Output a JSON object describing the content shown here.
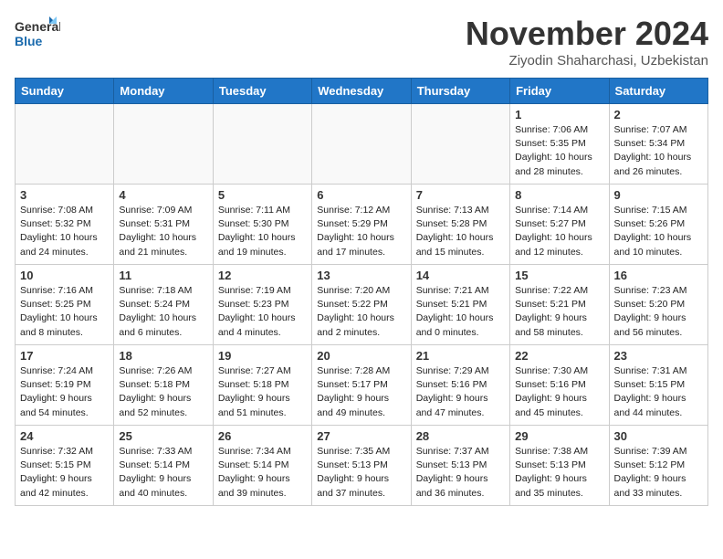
{
  "header": {
    "logo_line1": "General",
    "logo_line2": "Blue",
    "month_title": "November 2024",
    "location": "Ziyodin Shaharchasi, Uzbekistan"
  },
  "weekdays": [
    "Sunday",
    "Monday",
    "Tuesday",
    "Wednesday",
    "Thursday",
    "Friday",
    "Saturday"
  ],
  "weeks": [
    [
      {
        "day": "",
        "info": ""
      },
      {
        "day": "",
        "info": ""
      },
      {
        "day": "",
        "info": ""
      },
      {
        "day": "",
        "info": ""
      },
      {
        "day": "",
        "info": ""
      },
      {
        "day": "1",
        "info": "Sunrise: 7:06 AM\nSunset: 5:35 PM\nDaylight: 10 hours and 28 minutes."
      },
      {
        "day": "2",
        "info": "Sunrise: 7:07 AM\nSunset: 5:34 PM\nDaylight: 10 hours and 26 minutes."
      }
    ],
    [
      {
        "day": "3",
        "info": "Sunrise: 7:08 AM\nSunset: 5:32 PM\nDaylight: 10 hours and 24 minutes."
      },
      {
        "day": "4",
        "info": "Sunrise: 7:09 AM\nSunset: 5:31 PM\nDaylight: 10 hours and 21 minutes."
      },
      {
        "day": "5",
        "info": "Sunrise: 7:11 AM\nSunset: 5:30 PM\nDaylight: 10 hours and 19 minutes."
      },
      {
        "day": "6",
        "info": "Sunrise: 7:12 AM\nSunset: 5:29 PM\nDaylight: 10 hours and 17 minutes."
      },
      {
        "day": "7",
        "info": "Sunrise: 7:13 AM\nSunset: 5:28 PM\nDaylight: 10 hours and 15 minutes."
      },
      {
        "day": "8",
        "info": "Sunrise: 7:14 AM\nSunset: 5:27 PM\nDaylight: 10 hours and 12 minutes."
      },
      {
        "day": "9",
        "info": "Sunrise: 7:15 AM\nSunset: 5:26 PM\nDaylight: 10 hours and 10 minutes."
      }
    ],
    [
      {
        "day": "10",
        "info": "Sunrise: 7:16 AM\nSunset: 5:25 PM\nDaylight: 10 hours and 8 minutes."
      },
      {
        "day": "11",
        "info": "Sunrise: 7:18 AM\nSunset: 5:24 PM\nDaylight: 10 hours and 6 minutes."
      },
      {
        "day": "12",
        "info": "Sunrise: 7:19 AM\nSunset: 5:23 PM\nDaylight: 10 hours and 4 minutes."
      },
      {
        "day": "13",
        "info": "Sunrise: 7:20 AM\nSunset: 5:22 PM\nDaylight: 10 hours and 2 minutes."
      },
      {
        "day": "14",
        "info": "Sunrise: 7:21 AM\nSunset: 5:21 PM\nDaylight: 10 hours and 0 minutes."
      },
      {
        "day": "15",
        "info": "Sunrise: 7:22 AM\nSunset: 5:21 PM\nDaylight: 9 hours and 58 minutes."
      },
      {
        "day": "16",
        "info": "Sunrise: 7:23 AM\nSunset: 5:20 PM\nDaylight: 9 hours and 56 minutes."
      }
    ],
    [
      {
        "day": "17",
        "info": "Sunrise: 7:24 AM\nSunset: 5:19 PM\nDaylight: 9 hours and 54 minutes."
      },
      {
        "day": "18",
        "info": "Sunrise: 7:26 AM\nSunset: 5:18 PM\nDaylight: 9 hours and 52 minutes."
      },
      {
        "day": "19",
        "info": "Sunrise: 7:27 AM\nSunset: 5:18 PM\nDaylight: 9 hours and 51 minutes."
      },
      {
        "day": "20",
        "info": "Sunrise: 7:28 AM\nSunset: 5:17 PM\nDaylight: 9 hours and 49 minutes."
      },
      {
        "day": "21",
        "info": "Sunrise: 7:29 AM\nSunset: 5:16 PM\nDaylight: 9 hours and 47 minutes."
      },
      {
        "day": "22",
        "info": "Sunrise: 7:30 AM\nSunset: 5:16 PM\nDaylight: 9 hours and 45 minutes."
      },
      {
        "day": "23",
        "info": "Sunrise: 7:31 AM\nSunset: 5:15 PM\nDaylight: 9 hours and 44 minutes."
      }
    ],
    [
      {
        "day": "24",
        "info": "Sunrise: 7:32 AM\nSunset: 5:15 PM\nDaylight: 9 hours and 42 minutes."
      },
      {
        "day": "25",
        "info": "Sunrise: 7:33 AM\nSunset: 5:14 PM\nDaylight: 9 hours and 40 minutes."
      },
      {
        "day": "26",
        "info": "Sunrise: 7:34 AM\nSunset: 5:14 PM\nDaylight: 9 hours and 39 minutes."
      },
      {
        "day": "27",
        "info": "Sunrise: 7:35 AM\nSunset: 5:13 PM\nDaylight: 9 hours and 37 minutes."
      },
      {
        "day": "28",
        "info": "Sunrise: 7:37 AM\nSunset: 5:13 PM\nDaylight: 9 hours and 36 minutes."
      },
      {
        "day": "29",
        "info": "Sunrise: 7:38 AM\nSunset: 5:13 PM\nDaylight: 9 hours and 35 minutes."
      },
      {
        "day": "30",
        "info": "Sunrise: 7:39 AM\nSunset: 5:12 PM\nDaylight: 9 hours and 33 minutes."
      }
    ]
  ]
}
